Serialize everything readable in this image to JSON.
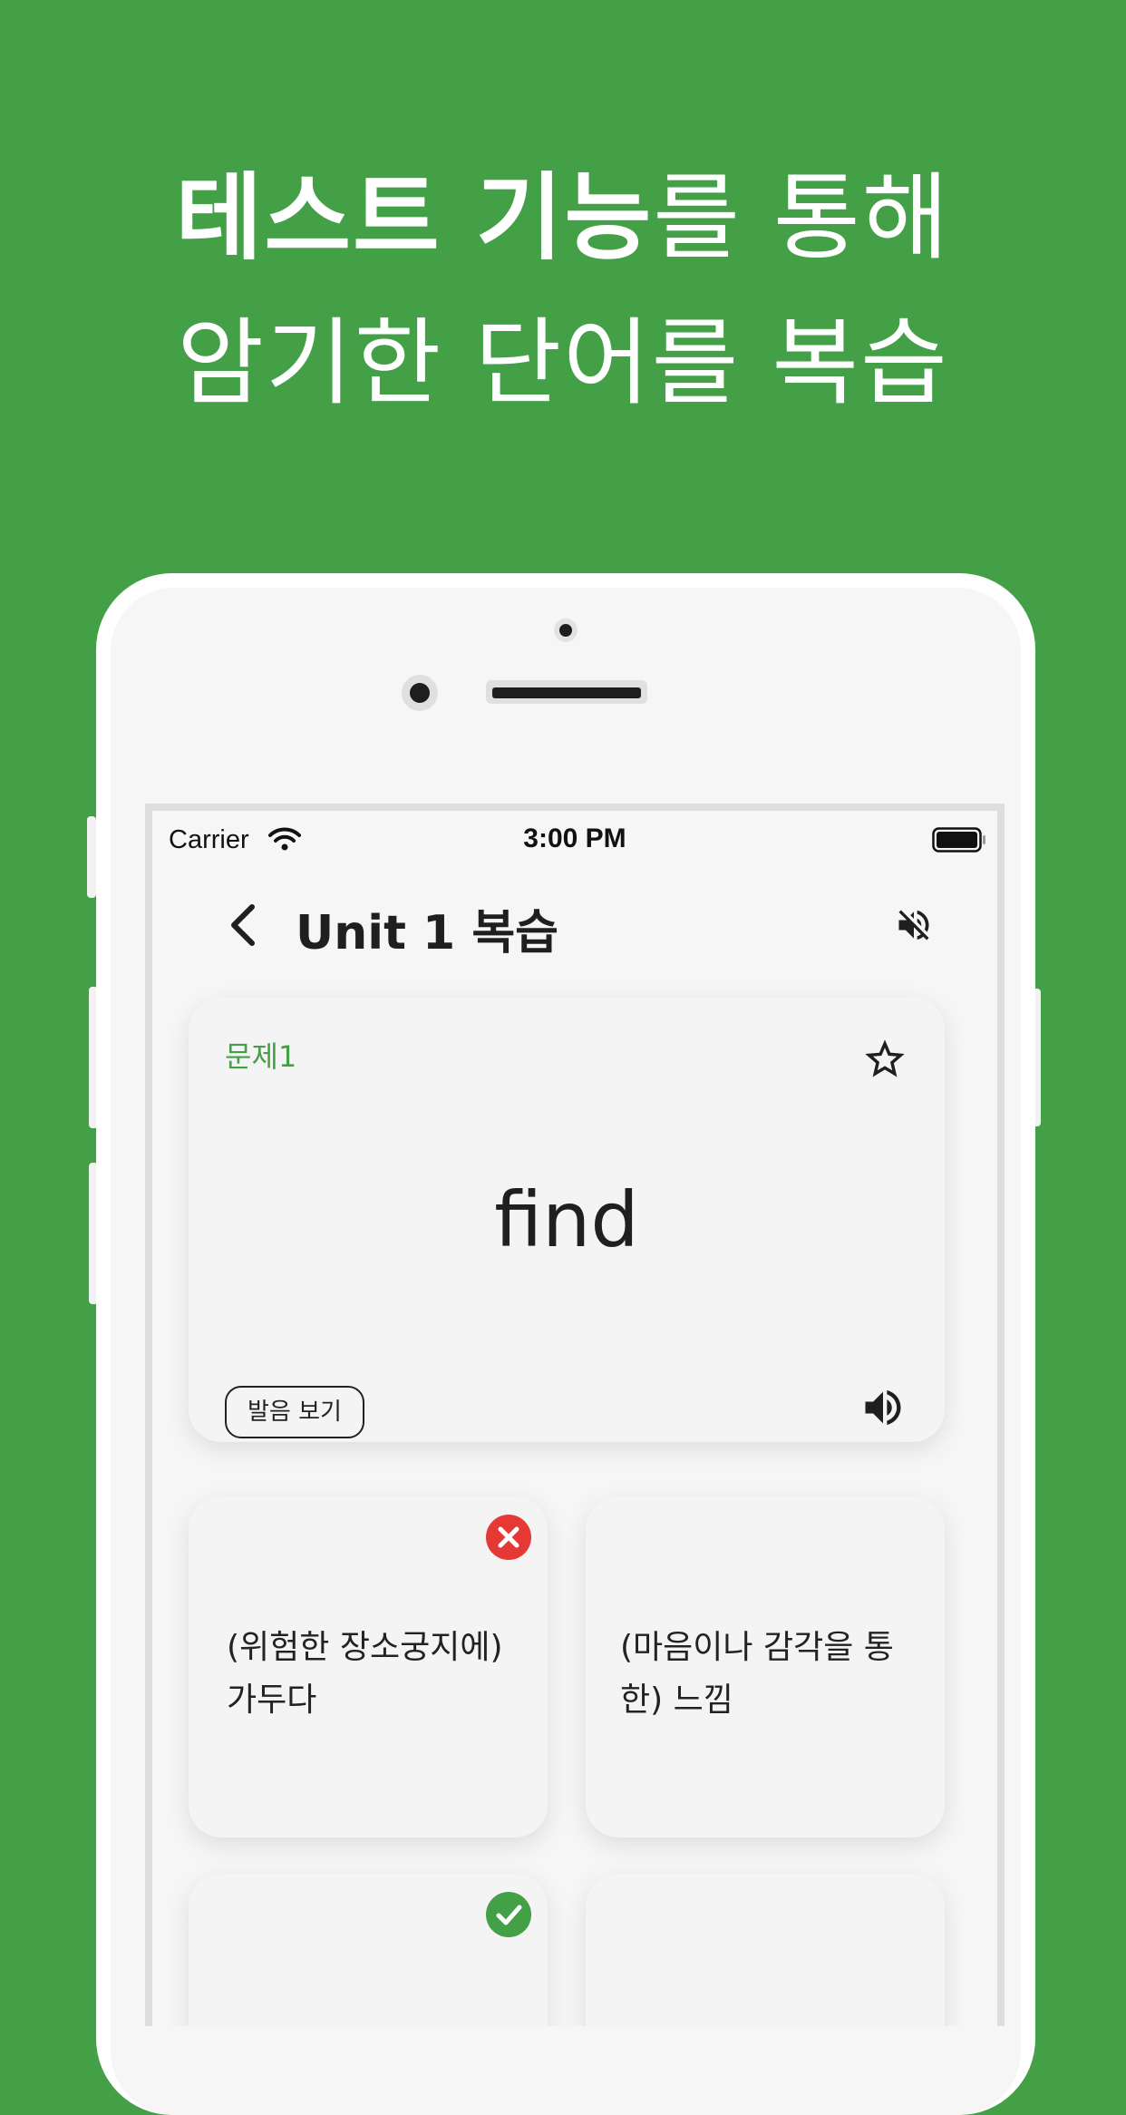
{
  "headline": {
    "line1_bold": "테스트 기능",
    "line1_rest": "를 통해",
    "line2": "암기한 단어를 복습"
  },
  "status_bar": {
    "carrier": "Carrier",
    "time": "3:00 PM"
  },
  "nav": {
    "back_icon": "chevron-left-icon",
    "title": "Unit 1 복습",
    "mute_icon": "volume-mute-icon"
  },
  "question": {
    "label": "문제1",
    "word": "find",
    "pronunciation_button": "발음 보기",
    "star_icon": "star-outline-icon",
    "speaker_icon": "speaker-icon"
  },
  "answers": [
    {
      "text": "(위험한 장소궁지에) 가두다",
      "status": "wrong",
      "icon": "x-circle-icon"
    },
    {
      "text": "(마음이나 감각을 통한) 느낌",
      "status": "none"
    },
    {
      "text": "",
      "status": "correct",
      "icon": "check-circle-icon"
    },
    {
      "text": "",
      "status": "none"
    }
  ],
  "colors": {
    "background": "#43a047",
    "accent": "#43a047",
    "wrong": "#e53935",
    "correct": "#43a047"
  }
}
